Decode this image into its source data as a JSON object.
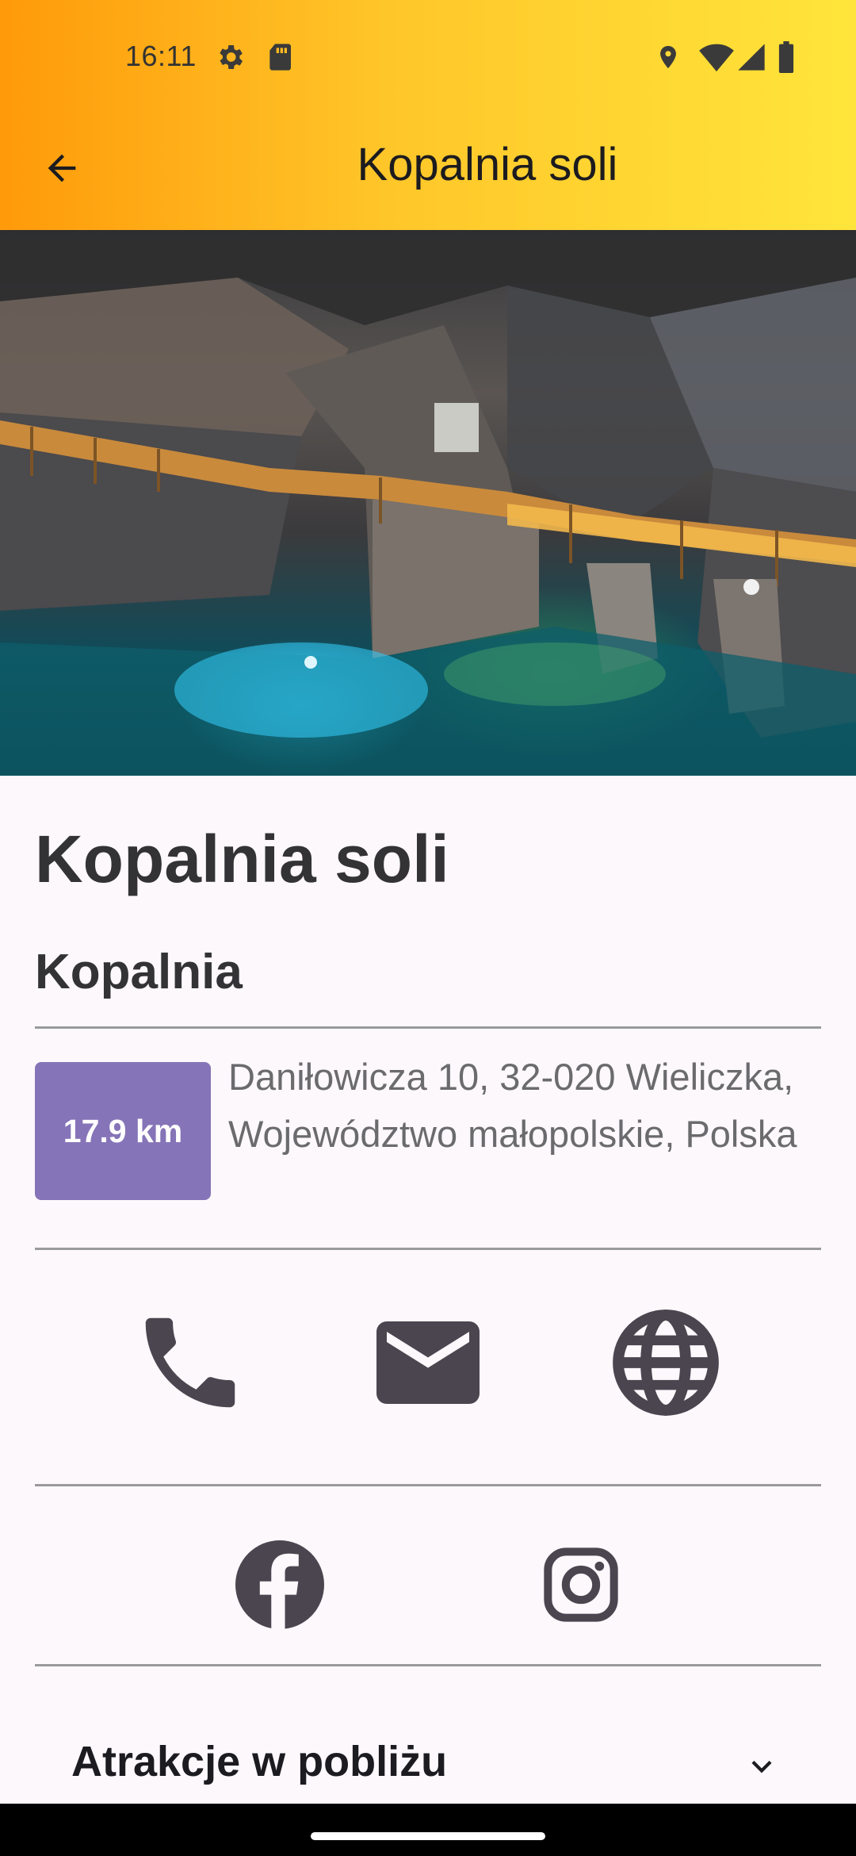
{
  "status_bar": {
    "time": "16:11",
    "icons": [
      "gear-icon",
      "sd-card-icon",
      "location-icon",
      "wifi-icon",
      "signal-icon",
      "battery-icon"
    ]
  },
  "app_bar": {
    "title": "Kopalnia soli",
    "back_icon": "arrow-back-icon",
    "gradient": [
      "#ff9a0a",
      "#ffe53b"
    ]
  },
  "hero_image": {
    "description_icon": "salt-mine-photo"
  },
  "place": {
    "name": "Kopalnia soli",
    "category": "Kopalnia",
    "distance": "17.9 km",
    "address": "Daniłowicza 10, 32-020 Wieliczka, Województwo małopolskie, Polska"
  },
  "contact": {
    "phone_icon": "phone-icon",
    "email_icon": "email-icon",
    "website_icon": "globe-icon"
  },
  "social": {
    "facebook_icon": "facebook-icon",
    "instagram_icon": "instagram-icon"
  },
  "nearby": {
    "label": "Atrakcje w pobliżu",
    "chevron": "chevron-down-icon"
  },
  "colors": {
    "badge": "#8674b8",
    "text_dark": "#333336",
    "text_muted": "#6b6b6e",
    "icon": "#4a454f"
  }
}
